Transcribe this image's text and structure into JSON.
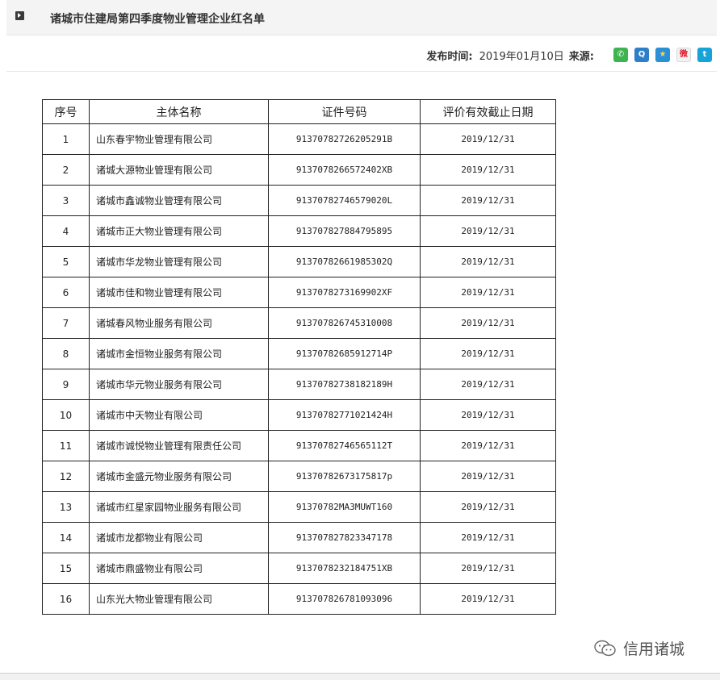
{
  "header": {
    "title": "诸城市住建局第四季度物业管理企业红名单"
  },
  "meta": {
    "publish_label": "发布时间:",
    "publish_date": "2019年01月10日",
    "source_label": "来源:"
  },
  "share": [
    {
      "name": "wechat-icon",
      "glyph": "✆"
    },
    {
      "name": "qq-icon",
      "glyph": "Q"
    },
    {
      "name": "qzone-icon",
      "glyph": "★"
    },
    {
      "name": "weibo-icon",
      "glyph": "微"
    },
    {
      "name": "tencent-weibo-icon",
      "glyph": "t"
    }
  ],
  "table": {
    "headers": [
      "序号",
      "主体名称",
      "证件号码",
      "评价有效截止日期"
    ],
    "rows": [
      [
        "1",
        "山东春宇物业管理有限公司",
        "91370782726205291B",
        "2019/12/31"
      ],
      [
        "2",
        "诸城大源物业管理有限公司",
        "913707826657240​2XB",
        "2019/12/31"
      ],
      [
        "3",
        "诸城市鑫诚物业管理有限公司",
        "91370782746579020L",
        "2019/12/31"
      ],
      [
        "4",
        "诸城市正大物业管理有限公司",
        "913707827884795895",
        "2019/12/31"
      ],
      [
        "5",
        "诸城市华龙物业管理有限公司",
        "91370782661985302Q",
        "2019/12/31"
      ],
      [
        "6",
        "诸城市佳和物业管理有限公司",
        "91370782731699​02XF",
        "2019/12/31"
      ],
      [
        "7",
        "诸城春风物业服务有限公司",
        "913707826745310008",
        "2019/12/31"
      ],
      [
        "8",
        "诸城市金恒物业服务有限公司",
        "91370782685912714P",
        "2019/12/31"
      ],
      [
        "9",
        "诸城市华元物业服务有限公司",
        "91370782738182189H",
        "2019/12/31"
      ],
      [
        "10",
        "诸城市中天物业有限公司",
        "91370782771021424H",
        "2019/12/31"
      ],
      [
        "11",
        "诸城市诚悦物业管理有限责任公司",
        "91370782746565112T",
        "2019/12/31"
      ],
      [
        "12",
        "诸城市金盛元物业服务有限公司",
        "91370782673175817p",
        "2019/12/31"
      ],
      [
        "13",
        "诸城市红星家园物业服务有限公司",
        "91370782MA3MUWT160",
        "2019/12/31"
      ],
      [
        "14",
        "诸城市龙都物业有限公司",
        "913707827823347178",
        "2019/12/31"
      ],
      [
        "15",
        "诸城市鼎盛物业有限公司",
        "91370782321847​51XB",
        "2019/12/31"
      ],
      [
        "16",
        "山东光大物业管理有限公司",
        "913707826781093096",
        "2019/12/31"
      ]
    ]
  },
  "watermark": {
    "text": "信用诸城"
  }
}
